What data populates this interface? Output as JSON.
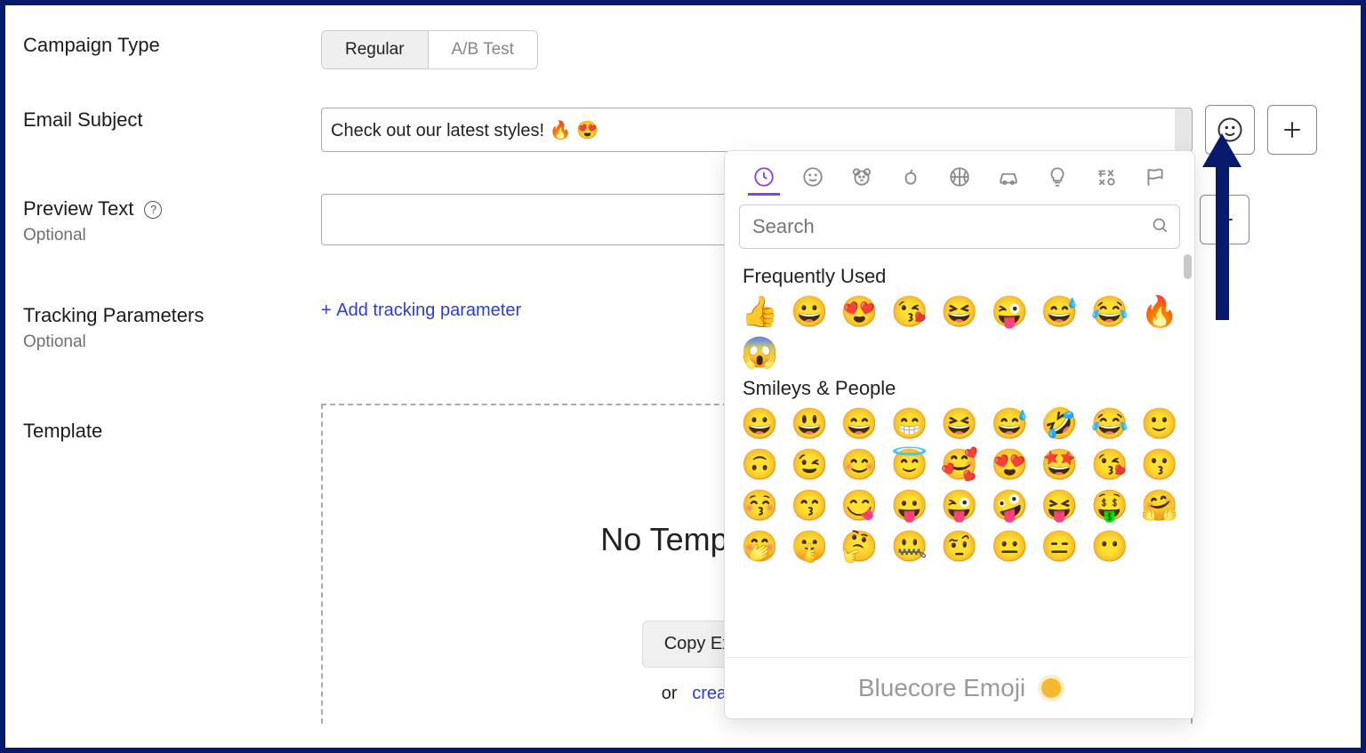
{
  "labels": {
    "campaign_type": "Campaign Type",
    "email_subject": "Email Subject",
    "preview_text": "Preview Text",
    "optional": "Optional",
    "tracking_params": "Tracking Parameters",
    "template": "Template"
  },
  "campaign_type_tabs": {
    "regular": "Regular",
    "ab_test": "A/B Test"
  },
  "email_subject_value": "Check out our latest styles! 🔥 😍",
  "preview_text_value": "",
  "tracking": {
    "add_link": "Add tracking parameter"
  },
  "template_area": {
    "title": "No Template Selected",
    "copy_btn": "Copy Existing Template",
    "or": "or",
    "create_link": "create new template"
  },
  "emoji_picker": {
    "search_placeholder": "Search",
    "freq_title": "Frequently Used",
    "freq": [
      "👍",
      "😀",
      "😍",
      "😘",
      "😆",
      "😜",
      "😅",
      "😂",
      "🔥",
      "😱"
    ],
    "smileys_title": "Smileys & People",
    "smileys": [
      "😀",
      "😃",
      "😄",
      "😁",
      "😆",
      "😅",
      "🤣",
      "😂",
      "🙂",
      "🙃",
      "😉",
      "😊",
      "😇",
      "🥰",
      "😍",
      "🤩",
      "😘",
      "😗",
      "😚",
      "😙",
      "😋",
      "😛",
      "😜",
      "🤪",
      "😝",
      "🤑",
      "🤗",
      "🤭",
      "🤫",
      "🤔",
      "🤐",
      "🤨",
      "😐",
      "😑",
      "😶"
    ],
    "footer": "Bluecore Emoji",
    "categories": [
      "recent",
      "smileys",
      "animals",
      "food",
      "activity",
      "travel",
      "objects",
      "symbols",
      "flags"
    ]
  }
}
